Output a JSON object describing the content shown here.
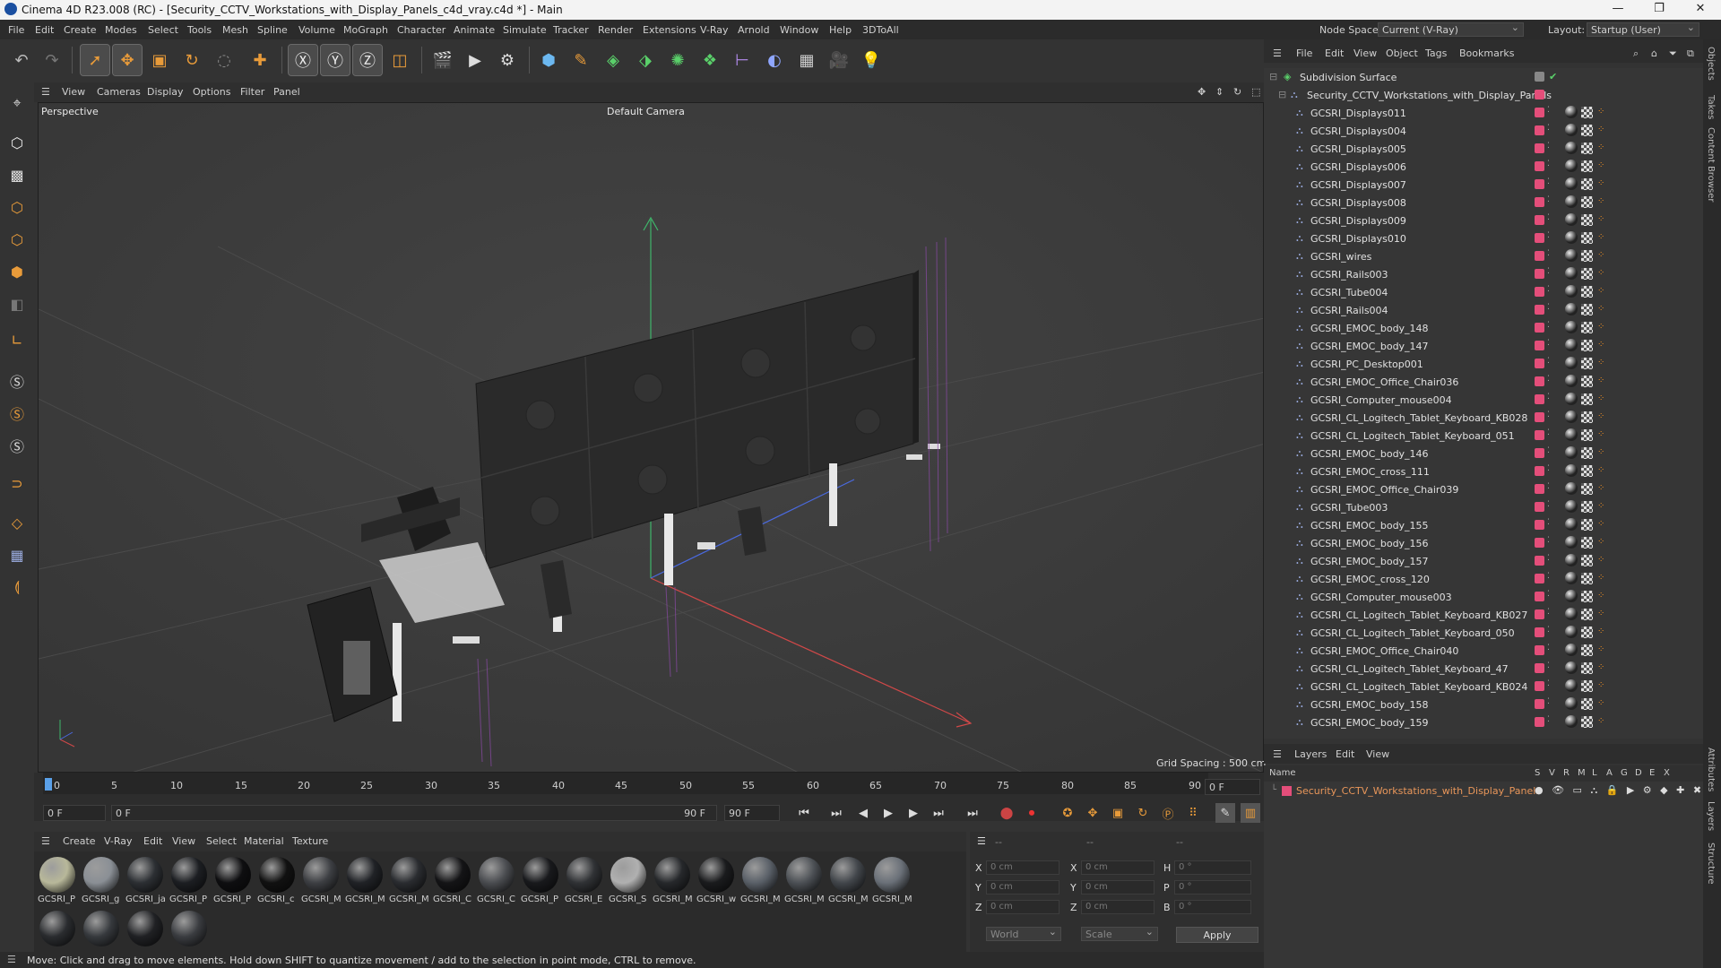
{
  "window": {
    "title": "Cinema 4D R23.008 (RC) - [Security_CCTV_Workstations_with_Display_Panels_c4d_vray.c4d *] - Main",
    "minimize": "—",
    "maximize": "❐",
    "close": "✕"
  },
  "menubar": {
    "items": [
      "File",
      "Edit",
      "Create",
      "Modes",
      "Select",
      "Tools",
      "Mesh",
      "Spline",
      "Volume",
      "MoGraph",
      "Character",
      "Animate",
      "Simulate",
      "Tracker",
      "Render",
      "Extensions",
      "V-Ray",
      "Arnold",
      "Window",
      "Help",
      "3DToAll"
    ],
    "node_space_label": "Node Space:",
    "node_space_value": "Current (V-Ray)",
    "layout_label": "Layout:",
    "layout_value": "Startup (User)"
  },
  "viewport": {
    "menu": [
      "View",
      "Cameras",
      "Display",
      "Options",
      "Filter",
      "Panel"
    ],
    "name": "Perspective",
    "camera": "Default Camera",
    "grid_spacing": "Grid Spacing : 500 cm"
  },
  "timeline": {
    "ticks": [
      "0",
      "5",
      "10",
      "15",
      "20",
      "25",
      "30",
      "35",
      "40",
      "45",
      "50",
      "55",
      "60",
      "65",
      "70",
      "75",
      "80",
      "85",
      "90"
    ],
    "current_frame": "0 F",
    "start_field": "0 F",
    "range_start": "0 F",
    "range_end": "90 F",
    "end_field": "90 F"
  },
  "materials": {
    "menu": [
      "Create",
      "V-Ray",
      "Edit",
      "View",
      "Select",
      "Material",
      "Texture"
    ],
    "items": [
      {
        "label": "GCSRI_P",
        "color": "#b8b89a"
      },
      {
        "label": "GCSRI_g",
        "color": "#8a8f95"
      },
      {
        "label": "GCSRI_ja",
        "color": "#2c2f33"
      },
      {
        "label": "GCSRI_P",
        "color": "#1c1e22"
      },
      {
        "label": "GCSRI_P",
        "color": "#0e0e10"
      },
      {
        "label": "GCSRI_c",
        "color": "#111111"
      },
      {
        "label": "GCSRI_M",
        "color": "#3d3f43"
      },
      {
        "label": "GCSRI_M",
        "color": "#202226"
      },
      {
        "label": "GCSRI_M",
        "color": "#2a2c30"
      },
      {
        "label": "GCSRI_C",
        "color": "#141416"
      },
      {
        "label": "GCSRI_C",
        "color": "#4a4c50"
      },
      {
        "label": "GCSRI_P",
        "color": "#18191c"
      },
      {
        "label": "GCSRI_E",
        "color": "#303235"
      },
      {
        "label": "GCSRI_S",
        "color": "#b0b0b0"
      },
      {
        "label": "GCSRI_M",
        "color": "#26282b"
      },
      {
        "label": "GCSRI_w",
        "color": "#1a1b1d"
      },
      {
        "label": "GCSRI_M",
        "color": "#5a6068"
      },
      {
        "label": "GCSRI_M",
        "color": "#4c5055"
      },
      {
        "label": "GCSRI_M",
        "color": "#42464b"
      },
      {
        "label": "GCSRI_M",
        "color": "#6a7078"
      },
      {
        "label": "",
        "color": "#2a2c2f"
      },
      {
        "label": "",
        "color": "#36393d"
      },
      {
        "label": "",
        "color": "#202124"
      },
      {
        "label": "",
        "color": "#3a3c40"
      }
    ]
  },
  "coordinates": {
    "header": [
      "--",
      "--",
      "--"
    ],
    "rows": [
      {
        "a": "X",
        "av": "0 cm",
        "b": "X",
        "bv": "0 cm",
        "c": "H",
        "cv": "0 °"
      },
      {
        "a": "Y",
        "av": "0 cm",
        "b": "Y",
        "bv": "0 cm",
        "c": "P",
        "cv": "0 °"
      },
      {
        "a": "Z",
        "av": "0 cm",
        "b": "Z",
        "bv": "0 cm",
        "c": "B",
        "cv": "0 °"
      }
    ],
    "world": "World",
    "scale": "Scale",
    "apply": "Apply"
  },
  "status": "Move: Click and drag to move elements. Hold down SHIFT to quantize movement / add to the selection in point mode, CTRL to remove.",
  "objects": {
    "menu": [
      "File",
      "Edit",
      "View",
      "Object",
      "Tags",
      "Bookmarks"
    ],
    "root": "Subdivision Surface",
    "group": "Security_CCTV_Workstations_with_Display_Panels",
    "items": [
      "GCSRI_Displays011",
      "GCSRI_Displays004",
      "GCSRI_Displays005",
      "GCSRI_Displays006",
      "GCSRI_Displays007",
      "GCSRI_Displays008",
      "GCSRI_Displays009",
      "GCSRI_Displays010",
      "GCSRI_wires",
      "GCSRI_Rails003",
      "GCSRI_Tube004",
      "GCSRI_Rails004",
      "GCSRI_EMOC_body_148",
      "GCSRI_EMOC_body_147",
      "GCSRI_PC_Desktop001",
      "GCSRI_EMOC_Office_Chair036",
      "GCSRI_Computer_mouse004",
      "GCSRI_CL_Logitech_Tablet_Keyboard_KB028",
      "GCSRI_CL_Logitech_Tablet_Keyboard_051",
      "GCSRI_EMOC_body_146",
      "GCSRI_EMOC_cross_111",
      "GCSRI_EMOC_Office_Chair039",
      "GCSRI_Tube003",
      "GCSRI_EMOC_body_155",
      "GCSRI_EMOC_body_156",
      "GCSRI_EMOC_body_157",
      "GCSRI_EMOC_cross_120",
      "GCSRI_Computer_mouse003",
      "GCSRI_CL_Logitech_Tablet_Keyboard_KB027",
      "GCSRI_CL_Logitech_Tablet_Keyboard_050",
      "GCSRI_EMOC_Office_Chair040",
      "GCSRI_CL_Logitech_Tablet_Keyboard_47",
      "GCSRI_CL_Logitech_Tablet_Keyboard_KB024",
      "GCSRI_EMOC_body_158",
      "GCSRI_EMOC_body_159"
    ]
  },
  "layers": {
    "menu": [
      "Layers",
      "Edit",
      "View"
    ],
    "col_name": "Name",
    "cols": [
      "S",
      "V",
      "R",
      "M",
      "L",
      "A",
      "G",
      "D",
      "E",
      "X"
    ],
    "row": "Security_CCTV_Workstations_with_Display_Panels"
  },
  "side_tabs": [
    "Objects",
    "Takes",
    "Content Browser",
    "Attributes",
    "Layers",
    "Structure"
  ],
  "colors": {
    "accent": "#e8965a",
    "layer_pink": "#e44e7a",
    "axis_x": "#d04848",
    "axis_y": "#3fb56a"
  }
}
